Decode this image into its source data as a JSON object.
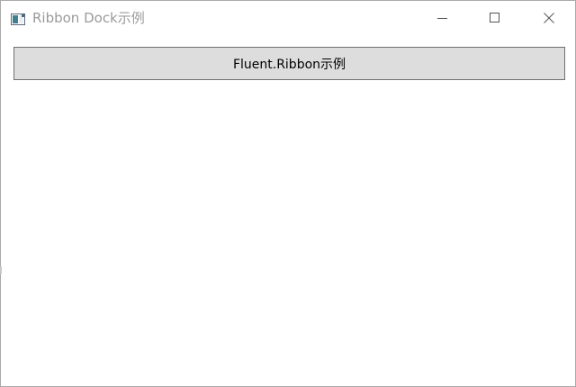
{
  "window": {
    "title": "Ribbon Dock示例"
  },
  "icons": {
    "app": "window-app-icon",
    "minimize": "minimize-icon",
    "maximize": "maximize-icon",
    "close": "close-icon"
  },
  "colors": {
    "title_text": "#9a9a9a",
    "button_background": "#dddddd",
    "button_border": "#707070",
    "window_border": "#aaaaaa"
  },
  "main": {
    "button_label": "Fluent.Ribbon示例"
  }
}
